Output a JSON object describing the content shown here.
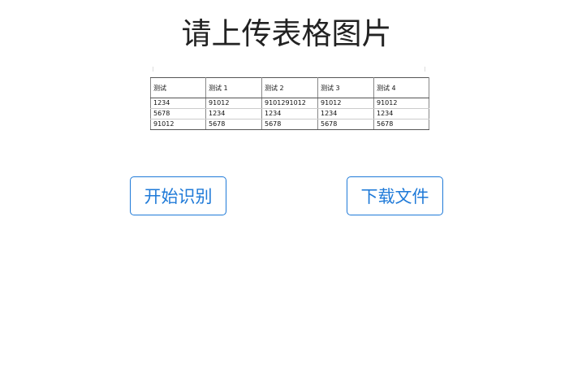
{
  "page": {
    "title": "请上传表格图片"
  },
  "table_preview": {
    "headers": [
      "测试",
      "测试 1",
      "测试 2",
      "测试 3",
      "测试 4"
    ],
    "rows": [
      [
        "1234",
        "91012",
        "9101291012",
        "91012",
        "91012"
      ],
      [
        "5678",
        "1234",
        "1234",
        "1234",
        "1234"
      ],
      [
        "91012",
        "5678",
        "5678",
        "5678",
        "5678"
      ]
    ]
  },
  "actions": {
    "recognize_label": "开始识别",
    "download_label": "下载文件"
  },
  "colors": {
    "accent": "#1f7ad8",
    "title_text": "#222222",
    "background": "#ffffff"
  }
}
